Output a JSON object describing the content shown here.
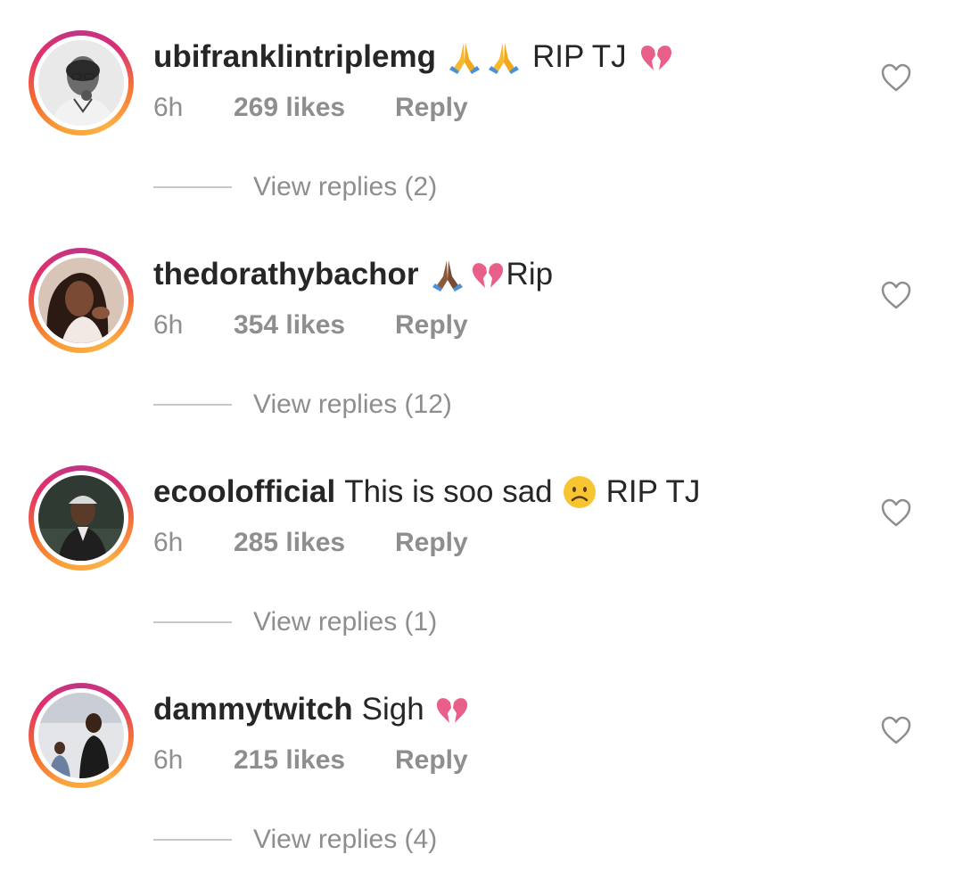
{
  "comments": [
    {
      "username": "ubifranklintriplemg",
      "text_after": "RIP TJ",
      "emojis_before": [
        "folded-hands",
        "folded-hands"
      ],
      "emojis_after": [
        "broken-heart"
      ],
      "time": "6h",
      "likes": "269 likes",
      "reply_label": "Reply",
      "view_replies": "View replies (2)",
      "avatar": "man-with-glasses-avatar"
    },
    {
      "username": "thedorathybachor",
      "text_after": "Rip",
      "emojis_before": [
        "folded-hands-dark",
        "broken-heart"
      ],
      "emojis_after": [],
      "time": "6h",
      "likes": "354 likes",
      "reply_label": "Reply",
      "view_replies": "View replies (12)",
      "avatar": "woman-avatar"
    },
    {
      "username": "ecoolofficial",
      "text_before": "This is soo sad",
      "emojis_mid": [
        "frowning-face"
      ],
      "text_after": "RIP TJ",
      "time": "6h",
      "likes": "285 likes",
      "reply_label": "Reply",
      "view_replies": "View replies (1)",
      "avatar": "man-in-cap-avatar"
    },
    {
      "username": "dammytwitch",
      "text_before": "Sigh",
      "emojis_mid": [
        "broken-heart"
      ],
      "time": "6h",
      "likes": "215 likes",
      "reply_label": "Reply",
      "view_replies": "View replies (4)",
      "avatar": "group-photo-avatar"
    }
  ],
  "colors": {
    "text_primary": "#262626",
    "text_secondary": "#8e8e8e",
    "story_ring_start": "#fcb045",
    "story_ring_end": "#c13584",
    "broken_heart": "#e8608a",
    "folded_hands": "#f5b82e"
  }
}
